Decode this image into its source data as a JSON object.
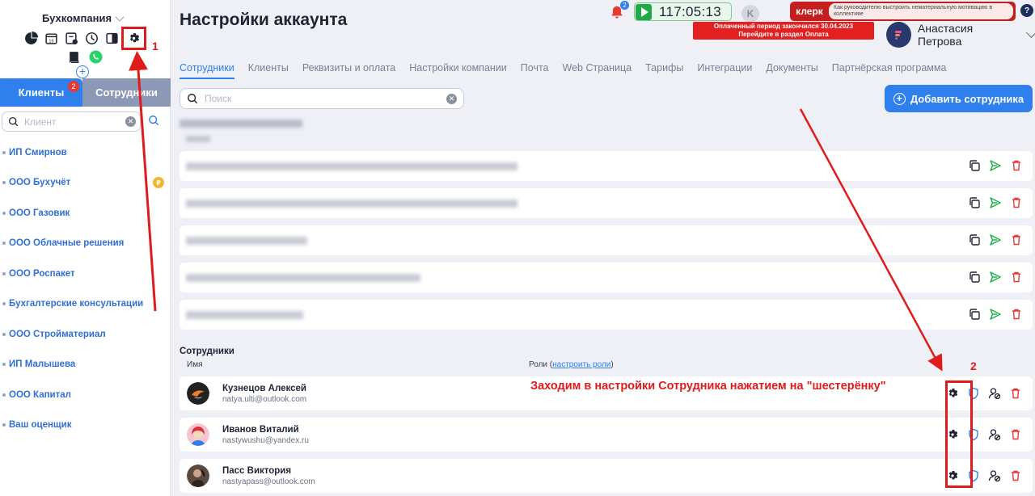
{
  "sidebar": {
    "company": "Бухкомпания",
    "clients_tab": "Клиенты",
    "clients_badge": "2",
    "employees_tab": "Сотрудники",
    "search_placeholder": "Клиент",
    "clients": [
      "ИП Смирнов",
      "ООО Бухучёт",
      "ООО Газовик",
      "ООО Облачные решения",
      "ООО Роспакет",
      "Бухгалтерские консультации",
      "ООО Стройматериал",
      "ИП Малышева",
      "ООО Капитал",
      "Ваш оценщик"
    ],
    "coin_label": "₽"
  },
  "header": {
    "title": "Настройки аккаунта",
    "bell_badge": "2",
    "timer": "117:05:13",
    "k_logo": "K",
    "klerk_brand": "клерк",
    "klerk_msg": "Как руководителю выстроить нематериальную мотивацию в коллективе",
    "help": "?",
    "alert_line1": "Оплаченный период закончился 30.04.2023",
    "alert_line2": "Перейдите в раздел Оплата",
    "user_name": "Анастасия Петрова"
  },
  "tabs": [
    "Сотрудники",
    "Клиенты",
    "Реквизиты и оплата",
    "Настройки компании",
    "Почта",
    "Web Страница",
    "Тарифы",
    "Интеграции",
    "Документы",
    "Партнёрская программа"
  ],
  "search": {
    "placeholder": "Поиск"
  },
  "add_button": "Добавить сотрудника",
  "employees": {
    "title": "Сотрудники",
    "col_name": "Имя",
    "col_roles": "Роли (",
    "roles_link": "настроить роли",
    "col_roles_end": ")",
    "rows": [
      {
        "name": "Кузнецов Алексей",
        "email": "natya.ulti@outlook.com"
      },
      {
        "name": "Иванов Виталий",
        "email": "nastywushu@yandex.ru"
      },
      {
        "name": "Пасс Виктория",
        "email": "nastyapass@outlook.com"
      }
    ]
  },
  "annotations": {
    "n1": "1",
    "n2": "2",
    "text": "Заходим в настройки Сотрудника нажатием на \"шестерёнку\""
  },
  "colors": {
    "accent": "#2f80ed",
    "annotation": "#e11b1b",
    "send": "#22b04b",
    "delete": "#e53935"
  }
}
